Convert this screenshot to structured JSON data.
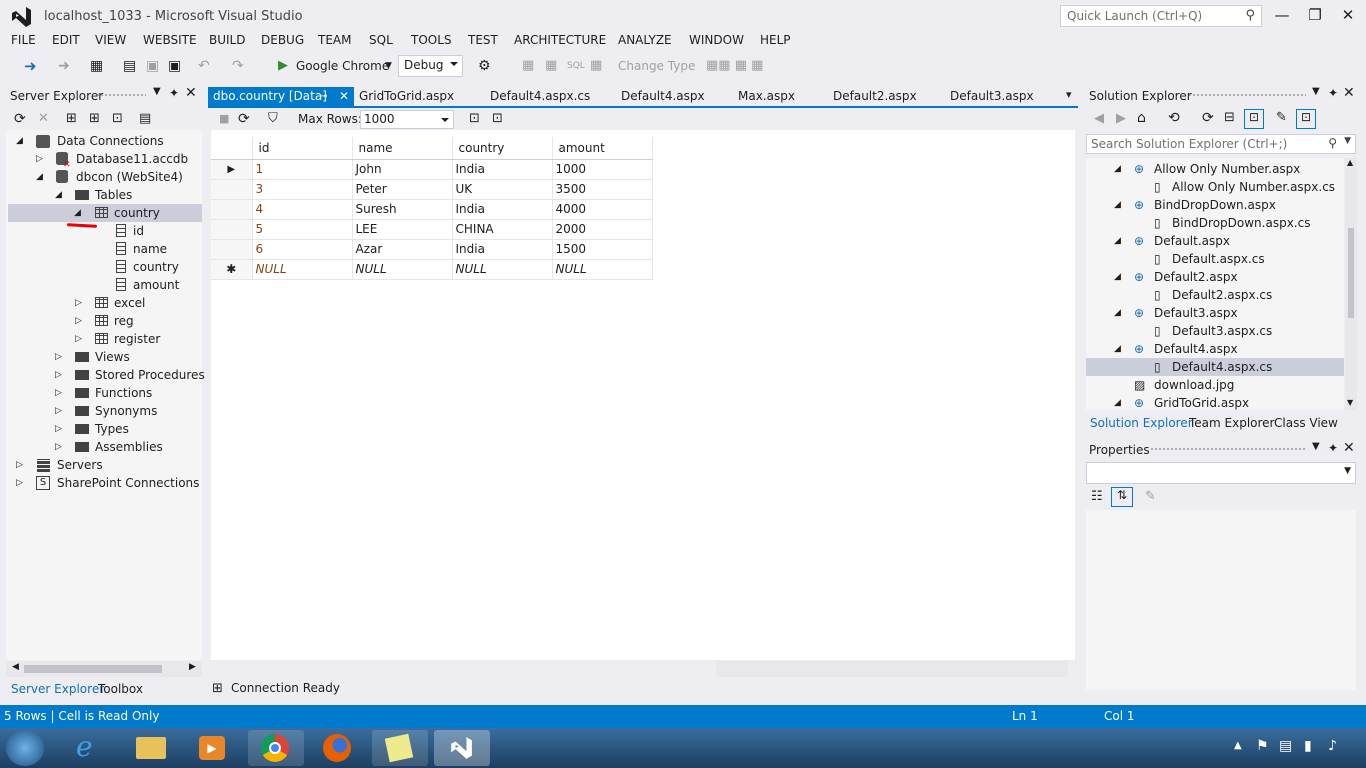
{
  "window": {
    "title": "localhost_1033 - Microsoft Visual Studio",
    "quick_launch_placeholder": "Quick Launch (Ctrl+Q)",
    "minimize": "—",
    "restore": "❐",
    "close": "✕"
  },
  "menu": [
    "FILE",
    "EDIT",
    "VIEW",
    "WEBSITE",
    "BUILD",
    "DEBUG",
    "TEAM",
    "SQL",
    "TOOLS",
    "TEST",
    "ARCHITECTURE",
    "ANALYZE",
    "WINDOW",
    "HELP"
  ],
  "toolbar": {
    "run_target": "Google Chrome",
    "config": "Debug",
    "change_type": "Change Type"
  },
  "server_explorer": {
    "title": "Server Explorer",
    "tree": [
      {
        "label": "Data Connections",
        "level": 0,
        "state": "open",
        "icon": "data-connections-icon"
      },
      {
        "label": "Database11.accdb",
        "level": 1,
        "state": "closed",
        "icon": "database-error-icon"
      },
      {
        "label": "dbcon (WebSite4)",
        "level": 1,
        "state": "open",
        "icon": "database-icon"
      },
      {
        "label": "Tables",
        "level": 2,
        "state": "open",
        "icon": "folder-icon"
      },
      {
        "label": "country",
        "level": 3,
        "state": "open",
        "icon": "table-icon",
        "selected": true
      },
      {
        "label": "id",
        "level": 4,
        "state": "none",
        "icon": "column-icon"
      },
      {
        "label": "name",
        "level": 4,
        "state": "none",
        "icon": "column-icon"
      },
      {
        "label": "country",
        "level": 4,
        "state": "none",
        "icon": "column-icon"
      },
      {
        "label": "amount",
        "level": 4,
        "state": "none",
        "icon": "column-icon"
      },
      {
        "label": "excel",
        "level": 3,
        "state": "closed",
        "icon": "table-icon"
      },
      {
        "label": "reg",
        "level": 3,
        "state": "closed",
        "icon": "table-icon"
      },
      {
        "label": "register",
        "level": 3,
        "state": "closed",
        "icon": "table-icon"
      },
      {
        "label": "Views",
        "level": 2,
        "state": "closed",
        "icon": "folder-icon"
      },
      {
        "label": "Stored Procedures",
        "level": 2,
        "state": "closed",
        "icon": "folder-icon"
      },
      {
        "label": "Functions",
        "level": 2,
        "state": "closed",
        "icon": "folder-icon"
      },
      {
        "label": "Synonyms",
        "level": 2,
        "state": "closed",
        "icon": "folder-icon"
      },
      {
        "label": "Types",
        "level": 2,
        "state": "closed",
        "icon": "folder-icon"
      },
      {
        "label": "Assemblies",
        "level": 2,
        "state": "closed",
        "icon": "folder-icon"
      },
      {
        "label": "Servers",
        "level": 0,
        "state": "closed",
        "icon": "servers-icon"
      },
      {
        "label": "SharePoint Connections",
        "level": 0,
        "state": "closed",
        "icon": "sharepoint-icon"
      }
    ],
    "bottom_tabs": [
      "Server Explorer",
      "Toolbox"
    ]
  },
  "doc_tabs": [
    {
      "label": "dbo.country [Data]",
      "active": true
    },
    {
      "label": "GridToGrid.aspx"
    },
    {
      "label": "Default4.aspx.cs"
    },
    {
      "label": "Default4.aspx"
    },
    {
      "label": "Max.aspx"
    },
    {
      "label": "Default2.aspx"
    },
    {
      "label": "Default3.aspx"
    }
  ],
  "data_toolbar": {
    "max_rows_label": "Max Rows:",
    "max_rows_value": "1000"
  },
  "grid": {
    "columns": [
      "id",
      "name",
      "country",
      "amount"
    ],
    "rows": [
      [
        "1",
        "John",
        "India",
        "1000"
      ],
      [
        "3",
        "Peter",
        "UK",
        "3500"
      ],
      [
        "4",
        "Suresh",
        "India",
        "4000"
      ],
      [
        "5",
        "LEE",
        "CHINA",
        "2000"
      ],
      [
        "6",
        "Azar",
        "India",
        "1500"
      ]
    ],
    "null_row": [
      "NULL",
      "NULL",
      "NULL",
      "NULL"
    ],
    "current_marker": "▶",
    "new_marker": "✱"
  },
  "connection_status": "Connection Ready",
  "solution_explorer": {
    "title": "Solution Explorer",
    "search_placeholder": "Search Solution Explorer (Ctrl+;)",
    "items": [
      {
        "label": "Allow Only Number.aspx",
        "level": 0,
        "state": "open"
      },
      {
        "label": "Allow Only Number.aspx.cs",
        "level": 1
      },
      {
        "label": "BindDropDown.aspx",
        "level": 0,
        "state": "open"
      },
      {
        "label": "BindDropDown.aspx.cs",
        "level": 1
      },
      {
        "label": "Default.aspx",
        "level": 0,
        "state": "open"
      },
      {
        "label": "Default.aspx.cs",
        "level": 1
      },
      {
        "label": "Default2.aspx",
        "level": 0,
        "state": "open"
      },
      {
        "label": "Default2.aspx.cs",
        "level": 1
      },
      {
        "label": "Default3.aspx",
        "level": 0,
        "state": "open"
      },
      {
        "label": "Default3.aspx.cs",
        "level": 1
      },
      {
        "label": "Default4.aspx",
        "level": 0,
        "state": "open"
      },
      {
        "label": "Default4.aspx.cs",
        "level": 1,
        "selected": true
      },
      {
        "label": "download.jpg",
        "level": 0
      },
      {
        "label": "GridToGrid.aspx",
        "level": 0,
        "state": "open"
      }
    ],
    "bottom_tabs": [
      "Solution Explorer",
      "Team Explorer",
      "Class View"
    ]
  },
  "properties": {
    "title": "Properties"
  },
  "status": {
    "left": "5 Rows | Cell is Read Only",
    "ln": "Ln 1",
    "col": "Col 1"
  },
  "colors": {
    "accent": "#007ACC",
    "chrome": "#EEEEF2",
    "selection": "#CCCEDB"
  }
}
